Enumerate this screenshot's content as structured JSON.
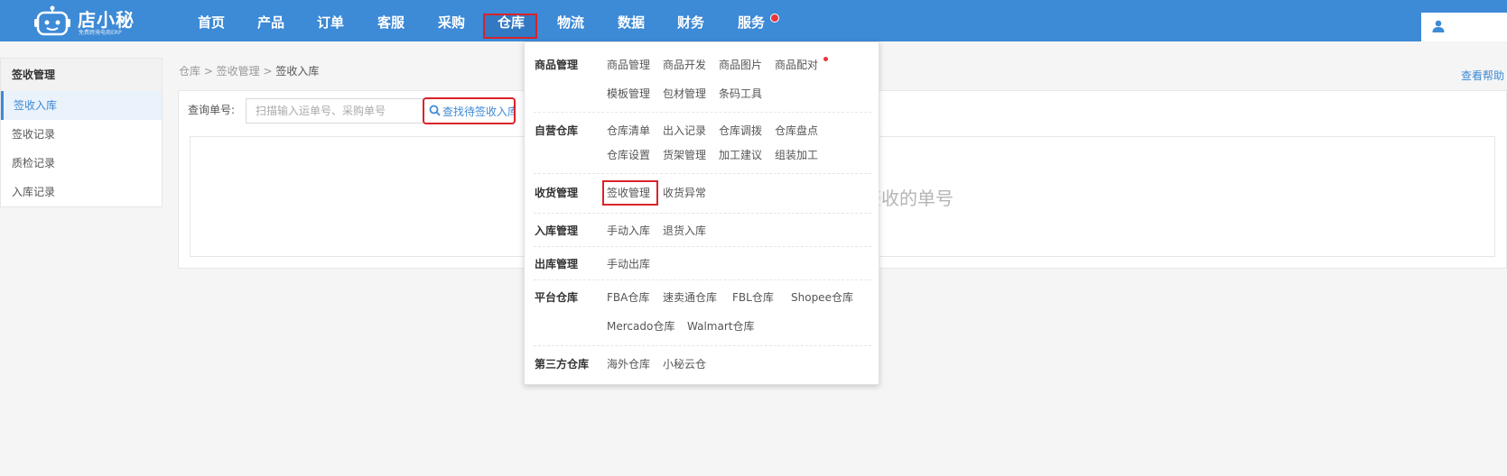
{
  "app": {
    "logo_name": "店小秘",
    "logo_sub": "免费跨境电商ERP"
  },
  "nav": {
    "items": [
      "首页",
      "产品",
      "订单",
      "客服",
      "采购",
      "仓库",
      "物流",
      "数据",
      "财务",
      "服务"
    ],
    "active": "仓库"
  },
  "sidebar": {
    "title": "签收管理",
    "items": [
      "签收入库",
      "签收记录",
      "质检记录",
      "入库记录"
    ],
    "active": "签收入库"
  },
  "breadcrumb": {
    "path": "仓库 > 签收管理 > ",
    "current": "签收入库"
  },
  "help_link": "查看帮助",
  "query": {
    "label": "查询单号:",
    "placeholder": "扫描输入运单号、采购单号",
    "value": "",
    "find_button": "查找待签收入库"
  },
  "empty_text": "签收的单号",
  "dropdown": {
    "groups": [
      {
        "title": "商品管理",
        "links": [
          "商品管理",
          "商品开发",
          "商品图片",
          "商品配对",
          "模板管理",
          "包材管理",
          "条码工具"
        ]
      },
      {
        "title": "自营仓库",
        "links": [
          "仓库清单",
          "出入记录",
          "仓库调拨",
          "仓库盘点",
          "仓库设置",
          "货架管理",
          "加工建议",
          "组装加工"
        ]
      },
      {
        "title": "收货管理",
        "links": [
          "签收管理",
          "收货异常"
        ]
      },
      {
        "title": "入库管理",
        "links": [
          "手动入库",
          "退货入库"
        ]
      },
      {
        "title": "出库管理",
        "links": [
          "手动出库"
        ]
      },
      {
        "title": "平台仓库",
        "links": [
          "FBA仓库",
          "速卖通仓库",
          "FBL仓库",
          "Shopee仓库",
          "Mercado仓库",
          "Walmart仓库"
        ]
      },
      {
        "title": "第三方仓库",
        "links": [
          "海外仓库",
          "小秘云仓"
        ]
      }
    ]
  },
  "colors": {
    "topbar": "#3d8ad6",
    "highlight": "#d9232b",
    "link": "#3d8ad6"
  }
}
